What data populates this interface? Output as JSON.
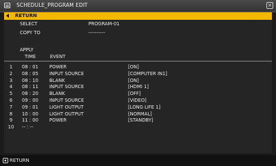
{
  "window": {
    "title": "SCHEDULE_PROGRAM EDIT",
    "title_icon": "menu-list-icon",
    "close_icon": "close-icon"
  },
  "menu": {
    "return_label": "RETURN",
    "select_label": "SELECT",
    "select_value": "PROGRAM-01",
    "copy_to_label": "COPY TO",
    "copy_to_value": "----------",
    "apply_label": "APPLY"
  },
  "table": {
    "headers": {
      "time": "TIME",
      "event": "EVENT"
    },
    "rows": [
      {
        "num": "1",
        "time": "08 : 01",
        "event": "POWER",
        "param": "[ON]"
      },
      {
        "num": "2",
        "time": "08 : 05",
        "event": "INPUT SOURCE",
        "param": "[COMPUTER IN1]"
      },
      {
        "num": "3",
        "time": "08 : 10",
        "event": "BLANK",
        "param": "[ON]"
      },
      {
        "num": "4",
        "time": "08 : 11",
        "event": "INPUT SOURCE",
        "param": "[HDMI 1]"
      },
      {
        "num": "5",
        "time": "08 : 20",
        "event": "BLANK",
        "param": "[OFF]"
      },
      {
        "num": "6",
        "time": "09 : 00",
        "event": "INPUT SOURCE",
        "param": "[VIDEO]"
      },
      {
        "num": "7",
        "time": "09 : 01",
        "event": "LIGHT OUTPUT",
        "param": "[LONG LIFE 1]"
      },
      {
        "num": "8",
        "time": "10 : 00",
        "event": "LIGHT OUTPUT",
        "param": "[NORMAL]"
      },
      {
        "num": "9",
        "time": "11 : 00",
        "event": "POWER",
        "param": "[STANDBY]"
      },
      {
        "num": "10",
        "time": "-- : --",
        "event": "",
        "param": ""
      }
    ]
  },
  "footer": {
    "back_icon": "back-arrow-icon",
    "return_label": "RETURN"
  },
  "colors": {
    "highlight": "#f5b800",
    "background": "#1c1c1c"
  }
}
